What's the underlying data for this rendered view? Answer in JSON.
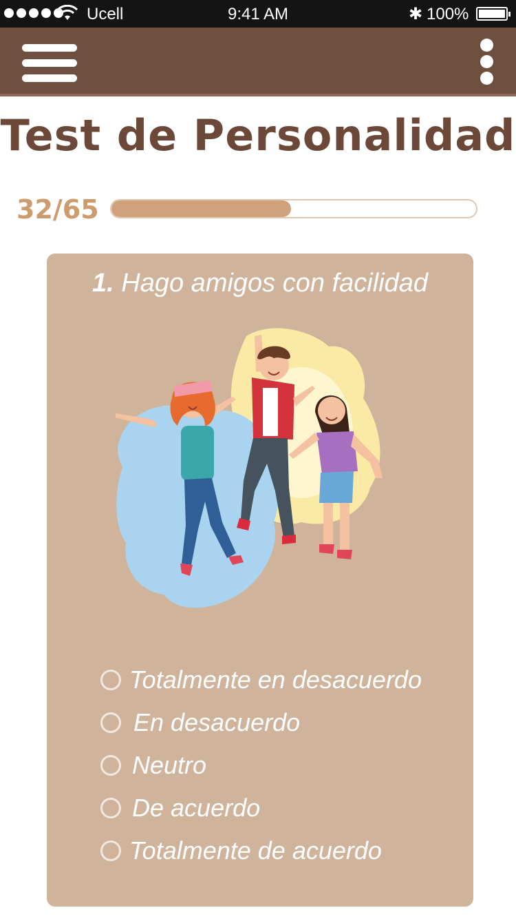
{
  "status_bar": {
    "carrier": "Ucell",
    "time": "9:41 AM",
    "battery": "100%"
  },
  "app_bar": {
    "menu_icon": "hamburger-menu-icon",
    "more_icon": "more-vertical-icon"
  },
  "page": {
    "title": "Test de Personalidad"
  },
  "progress": {
    "label": "32/65",
    "current": 32,
    "total": 65
  },
  "question": {
    "number": "1.",
    "text": "Hago amigos con facilidad",
    "illustration": "friends-jumping-illustration",
    "options": [
      {
        "label": "Totalmente en desacuerdo",
        "selected": false
      },
      {
        "label": "En desacuerdo",
        "selected": false
      },
      {
        "label": "Neutro",
        "selected": false
      },
      {
        "label": "De acuerdo",
        "selected": false
      },
      {
        "label": "Totalmente de acuerdo",
        "selected": false
      }
    ]
  },
  "colors": {
    "app_bar": "#6e4f40",
    "title": "#6b4838",
    "progress_label": "#cc9c6f",
    "progress_fill": "#cfa27c",
    "card": "#d0b39b"
  }
}
